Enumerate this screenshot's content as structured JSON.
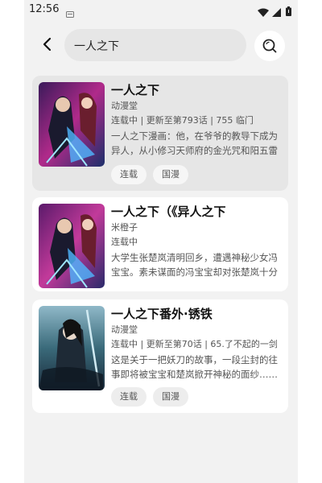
{
  "status_bar": {
    "time": "12:56",
    "icons": [
      "notification-icon",
      "wifi-icon",
      "signal-icon",
      "battery-icon"
    ]
  },
  "search": {
    "query": "一人之下",
    "back_icon": "back-arrow-icon",
    "search_icon": "search-icon"
  },
  "results": [
    {
      "title": "一人之下",
      "line1": "动漫堂",
      "line2": "连载中 | 更新至第793话 | 755 临门",
      "description": "一人之下漫画：他，在爷爷的教导下成为异人，从小修习天师府的金光咒和阳五雷",
      "tags": [
        "连载",
        "国漫"
      ],
      "selected": true
    },
    {
      "title": "一人之下（《异人之下",
      "line1": "米橙子",
      "line2": "连载中",
      "description": "大学生张楚岚清明回乡，遭遇神秘少女冯宝宝。素未谋面的冯宝宝却对张楚岚十分熟悉",
      "tags": [],
      "selected": false
    },
    {
      "title": "一人之下番外·锈铁",
      "line1": "动漫堂",
      "line2": "连载中 | 更新至第70话 | 65.了不起的一剑",
      "description": "这是关于一把妖刀的故事，一段尘封的往事即将被宝宝和楚岚掀开神秘的面纱……",
      "tags": [
        "连载",
        "国漫"
      ],
      "selected": false
    }
  ],
  "colors": {
    "background": "#f2f2f2",
    "card": "#ffffff",
    "card_selected": "#e6e6e6",
    "tag_bg": "#ededed"
  }
}
